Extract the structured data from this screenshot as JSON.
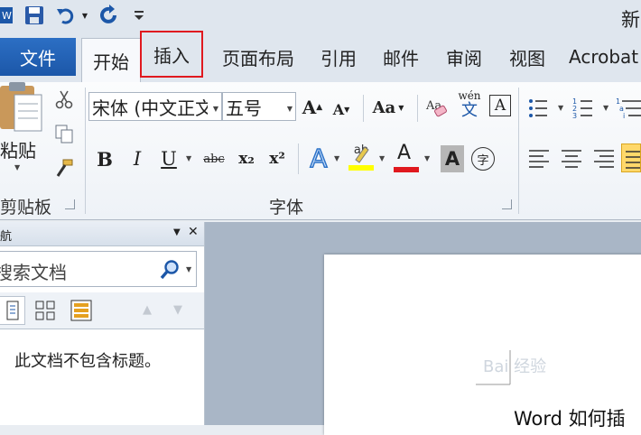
{
  "window": {
    "title_fragment": "新"
  },
  "qat": {
    "icons": [
      "word-logo-icon",
      "save-icon",
      "undo-icon",
      "redo-icon",
      "customize-qat-icon"
    ]
  },
  "tabs": [
    {
      "label": "文件"
    },
    {
      "label": "开始"
    },
    {
      "label": "插入"
    },
    {
      "label": "页面布局"
    },
    {
      "label": "引用"
    },
    {
      "label": "邮件"
    },
    {
      "label": "审阅"
    },
    {
      "label": "视图"
    },
    {
      "label": "Acrobat"
    }
  ],
  "clipboard": {
    "paste_label": "粘贴",
    "group_label": "剪贴板"
  },
  "font": {
    "font_name": "宋体 (中文正文",
    "font_size": "五号",
    "group_label": "字体",
    "grow_glyph": "A",
    "shrink_glyph": "A",
    "case_glyph": "Aa",
    "phonetic_glyph": "wén",
    "phonetic_sub": "文",
    "border_glyph": "A",
    "bold": "B",
    "italic": "I",
    "underline": "U",
    "strike": "abc",
    "subscript": "x₂",
    "superscript": "x²",
    "effects_glyph": "A",
    "highlight_glyph": "ab",
    "color_glyph": "A",
    "shading_glyph": "A",
    "enclose_glyph": "字",
    "highlight_color": "#ffff00",
    "font_color": "#e0191f"
  },
  "nav": {
    "title": "导航",
    "search_placeholder": "搜索文档",
    "message": "此文档不包含标题。"
  },
  "document": {
    "text": "Word 如何插",
    "watermark": "Bai 经验"
  },
  "accent": {
    "file_tab": "#1c57a8",
    "highlight_box": "#e0191f"
  }
}
